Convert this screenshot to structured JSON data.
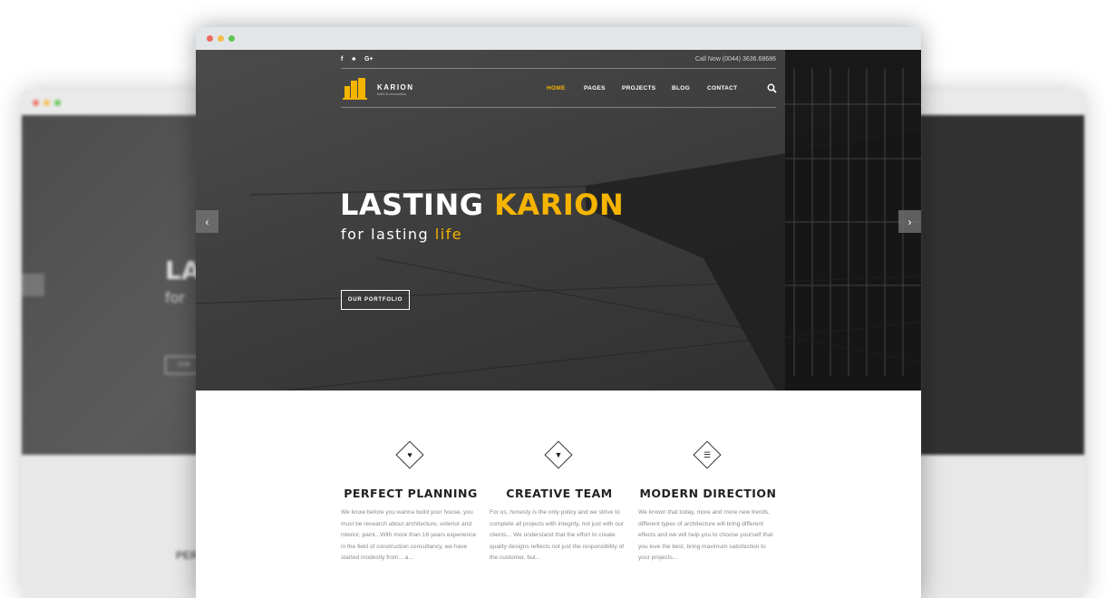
{
  "colors": {
    "accent": "#f5b400",
    "dot_red": "#ee6a5f",
    "dot_yellow": "#f5bd4f",
    "dot_green": "#61c454"
  },
  "topbar": {
    "social_icons": [
      "facebook-icon",
      "twitter-icon",
      "google-plus-icon"
    ],
    "social_glyphs": [
      "f",
      "♣",
      "G+"
    ],
    "call_now": "Call Now (0044) 3636.68686"
  },
  "brand": {
    "name": "KARION",
    "tagline": "build & renovation"
  },
  "nav": {
    "items": [
      "HOME",
      "PAGES",
      "PROJECTS",
      "BLOG",
      "CONTACT"
    ],
    "active": "HOME"
  },
  "hero": {
    "title_main": "LASTING ",
    "title_accent": "KARION",
    "subtitle_main": "for lasting ",
    "subtitle_accent": "life",
    "button_label": "OUR PORTFOLIO",
    "prev_arrow": "‹",
    "next_arrow": "›"
  },
  "features": [
    {
      "icon": "shield-check-icon",
      "glyph": "♥",
      "title": "PERFECT PLANNING",
      "text": "We know before you wanna build your house, you must be research about architecture, exterior and interior, paint...With more than 16 years experience in the field of construction consultancy, we have started modestly from... a..."
    },
    {
      "icon": "bookmark-icon",
      "glyph": "▼",
      "title": "CREATIVE TEAM",
      "text": "For us, honesty is the only policy and we strive to complete all projects with integrity, not just with our clients... We understand that the effort to create quality designs reflects not just the responsibility of the customer, but..."
    },
    {
      "icon": "database-icon",
      "glyph": "☰",
      "title": "MODERN DIRECTION",
      "text": "We known that today, more and more new trends, different types of architecture will bring different effects and we will help you to choose yourself that you love the best, bring maximum satisfaction to your projects..."
    }
  ],
  "background_mockup": {
    "title_fragment": "LA",
    "subtitle_fragment": "for",
    "button_fragment": "OUR",
    "feature_fragment": "PER"
  }
}
